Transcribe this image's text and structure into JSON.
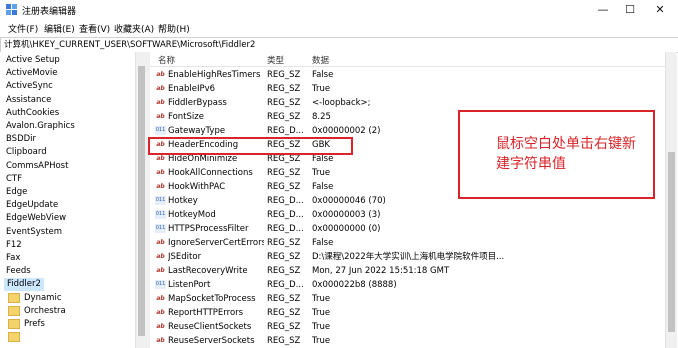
{
  "window": {
    "title": "注册表编辑器",
    "controls": {
      "minimize": "—",
      "maximize": "☐",
      "close": "✕"
    }
  },
  "menu": [
    "文件(F)",
    "编辑(E)",
    "查看(V)",
    "收藏夹(A)",
    "帮助(H)"
  ],
  "address": "计算机\\HKEY_CURRENT_USER\\SOFTWARE\\Microsoft\\Fiddler2",
  "tree": {
    "items": [
      "Active Setup",
      "ActiveMovie",
      "ActiveSync",
      "Assistance",
      "AuthCookies",
      "Avalon.Graphics",
      "BSDDir",
      "Clipboard",
      "CommsAPHost",
      "CTF",
      "Edge",
      "EdgeUpdate",
      "EdgeWebView",
      "EventSystem",
      "F12",
      "Fax",
      "Feeds",
      "Fiddler2"
    ],
    "selected": "Fiddler2",
    "subfolders": [
      "Dynamic",
      "Orchestra",
      "Prefs"
    ]
  },
  "columns": {
    "name": "名称",
    "type": "类型",
    "data": "数据"
  },
  "rows": [
    {
      "icon": "ab",
      "name": "EnableHighResTimers",
      "type": "REG_SZ",
      "data": "False"
    },
    {
      "icon": "ab",
      "name": "EnableIPv6",
      "type": "REG_SZ",
      "data": "True"
    },
    {
      "icon": "ab",
      "name": "FiddlerBypass",
      "type": "REG_SZ",
      "data": "<-loopback>;"
    },
    {
      "icon": "ab",
      "name": "FontSize",
      "type": "REG_SZ",
      "data": "8.25"
    },
    {
      "icon": "bin",
      "name": "GatewayType",
      "type": "REG_D...",
      "data": "0x00000002 (2)"
    },
    {
      "icon": "ab",
      "name": "HeaderEncoding",
      "type": "REG_SZ",
      "data": "GBK"
    },
    {
      "icon": "ab",
      "name": "HideOnMinimize",
      "type": "REG_SZ",
      "data": "False"
    },
    {
      "icon": "ab",
      "name": "HookAllConnections",
      "type": "REG_SZ",
      "data": "True"
    },
    {
      "icon": "ab",
      "name": "HookWithPAC",
      "type": "REG_SZ",
      "data": "False"
    },
    {
      "icon": "bin",
      "name": "Hotkey",
      "type": "REG_D...",
      "data": "0x00000046 (70)"
    },
    {
      "icon": "bin",
      "name": "HotkeyMod",
      "type": "REG_D...",
      "data": "0x00000003 (3)"
    },
    {
      "icon": "bin",
      "name": "HTTPSProcessFilter",
      "type": "REG_D...",
      "data": "0x00000000 (0)"
    },
    {
      "icon": "ab",
      "name": "IgnoreServerCertErrors",
      "type": "REG_SZ",
      "data": "False"
    },
    {
      "icon": "ab",
      "name": "JSEditor",
      "type": "REG_SZ",
      "data": "D:\\课程\\2022年大学实训\\上海机电学院软件项目..."
    },
    {
      "icon": "ab",
      "name": "LastRecoveryWrite",
      "type": "REG_SZ",
      "data": "Mon, 27 Jun 2022 15:51:18 GMT"
    },
    {
      "icon": "bin",
      "name": "ListenPort",
      "type": "REG_D...",
      "data": "0x000022b8 (8888)"
    },
    {
      "icon": "ab",
      "name": "MapSocketToProcess",
      "type": "REG_SZ",
      "data": "True"
    },
    {
      "icon": "ab",
      "name": "ReportHTTPErrors",
      "type": "REG_SZ",
      "data": "True"
    },
    {
      "icon": "ab",
      "name": "ReuseClientSockets",
      "type": "REG_SZ",
      "data": "True"
    },
    {
      "icon": "ab",
      "name": "ReuseServerSockets",
      "type": "REG_SZ",
      "data": "True"
    }
  ],
  "icon_labels": {
    "ab": "ab",
    "bin": "011"
  },
  "annotation": {
    "text": "鼠标空白处单击右键新建字符串值"
  },
  "colors": {
    "annotation": "#d9252a",
    "selection": "#cce8ff",
    "folder": "#f5d36b"
  }
}
